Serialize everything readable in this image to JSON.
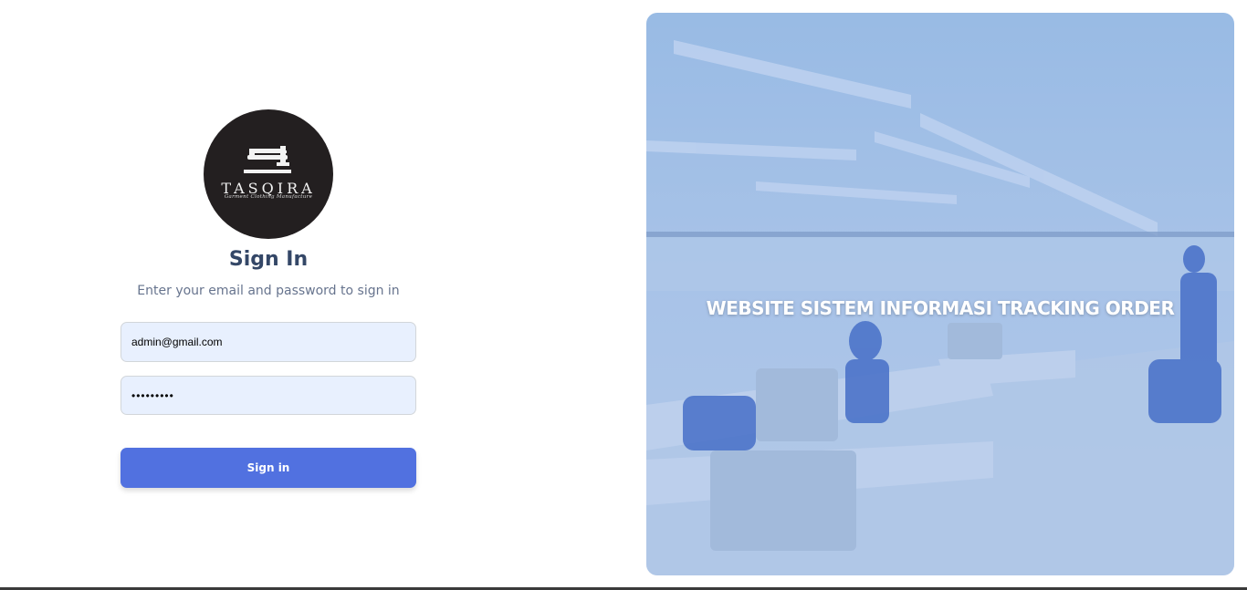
{
  "brand": {
    "name": "TASQIRA",
    "tagline": "Garment Clothing Manufacture"
  },
  "signin": {
    "title": "Sign In",
    "subtitle": "Enter your email and password to sign in",
    "email_value": "admin@gmail.com",
    "password_value": "•••••••••",
    "button_label": "Sign in"
  },
  "hero": {
    "title": "WEBSITE SISTEM INFORMASI TRACKING ORDER",
    "image": "garment-factory-photo"
  },
  "colors": {
    "primary": "#5171e0",
    "heading": "#344767",
    "input_bg": "#e8f0fe",
    "logo_bg": "#231f20"
  }
}
